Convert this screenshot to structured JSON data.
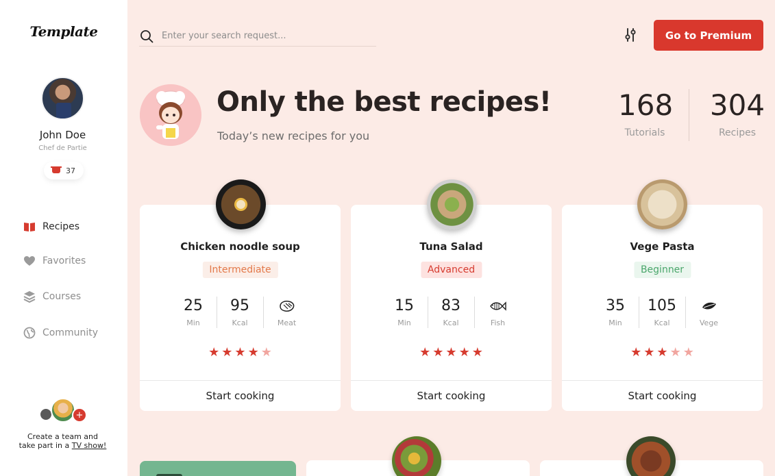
{
  "app": {
    "logo": "Template"
  },
  "user": {
    "name": "John Doe",
    "role": "Chef de Partie",
    "badge_count": "37"
  },
  "nav": {
    "items": [
      {
        "label": "Recipes",
        "icon": "book-icon",
        "active": true
      },
      {
        "label": "Favorites",
        "icon": "heart-icon",
        "active": false
      },
      {
        "label": "Courses",
        "icon": "layers-icon",
        "active": false
      },
      {
        "label": "Community",
        "icon": "globe-icon",
        "active": false
      }
    ]
  },
  "team": {
    "line1": "Create a team and",
    "line2_prefix": "take part in a ",
    "link": "TV show!"
  },
  "search": {
    "placeholder": "Enter your search request..."
  },
  "header": {
    "premium_label": "Go to Premium"
  },
  "hero": {
    "title": "Only the best recipes!",
    "subtitle": "Today’s new recipes for you"
  },
  "stats": [
    {
      "value": "168",
      "label": "Tutorials"
    },
    {
      "value": "304",
      "label": "Recipes"
    }
  ],
  "recipes": [
    {
      "title": "Chicken noodle soup",
      "level": "Intermediate",
      "time": "25",
      "time_unit": "Min",
      "kcal": "95",
      "kcal_unit": "Kcal",
      "type": "Meat",
      "type_icon": "steak-icon",
      "rating": 4,
      "rating_max": 5,
      "action": "Start cooking"
    },
    {
      "title": "Tuna Salad",
      "level": "Advanced",
      "time": "15",
      "time_unit": "Min",
      "kcal": "83",
      "kcal_unit": "Kcal",
      "type": "Fish",
      "type_icon": "fish-icon",
      "rating": 5,
      "rating_max": 5,
      "action": "Start cooking"
    },
    {
      "title": "Vege Pasta",
      "level": "Beginner",
      "time": "35",
      "time_unit": "Min",
      "kcal": "105",
      "kcal_unit": "Kcal",
      "type": "Vege",
      "type_icon": "leaf-icon",
      "rating": 3,
      "rating_max": 5,
      "action": "Start cooking"
    }
  ],
  "colors": {
    "accent": "#d9382d",
    "background": "#fcebe6",
    "intermediate": "#e3794a",
    "advanced": "#d63b2f",
    "beginner": "#4aa66b"
  }
}
